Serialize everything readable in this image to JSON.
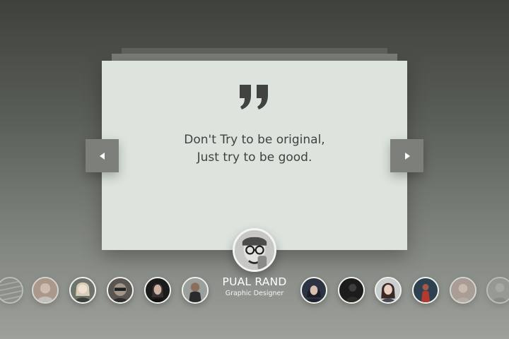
{
  "quote": {
    "icon": "quote-mark-icon",
    "line1": "Don't Try to be original,",
    "line2": "Just try to be good."
  },
  "navigation": {
    "prev_icon": "triangle-left-icon",
    "next_icon": "triangle-right-icon"
  },
  "person": {
    "name": "PUAL RAND",
    "role": "Graphic Designer",
    "avatar": "person-photo"
  },
  "testimonial_avatars": {
    "left": [
      {
        "photo": "striped-abstract-avatar",
        "tone": "#8b8b88"
      },
      {
        "photo": "woman-portrait-avatar",
        "tone": "#b89b8a"
      },
      {
        "photo": "woman-portrait-avatar",
        "tone": "#6d746b"
      },
      {
        "photo": "man-glasses-avatar",
        "tone": "#5a5550"
      },
      {
        "photo": "woman-dark-avatar",
        "tone": "#1b1b1c"
      },
      {
        "photo": "man-portrait-avatar",
        "tone": "#9aa09b"
      }
    ],
    "right": [
      {
        "photo": "woman-hood-avatar",
        "tone": "#2c3342"
      },
      {
        "photo": "man-dark-avatar",
        "tone": "#1c1c1c"
      },
      {
        "photo": "woman-smiling-avatar",
        "tone": "#c9cfd1"
      },
      {
        "photo": "woman-red-avatar",
        "tone": "#2e4150"
      },
      {
        "photo": "woman-light-avatar",
        "tone": "#b4a29a"
      },
      {
        "photo": "person-grey-avatar",
        "tone": "#9fa19d"
      }
    ]
  },
  "colors": {
    "card": "#dde3dd",
    "button": "#7d7f7b",
    "text": "#3f423f"
  }
}
